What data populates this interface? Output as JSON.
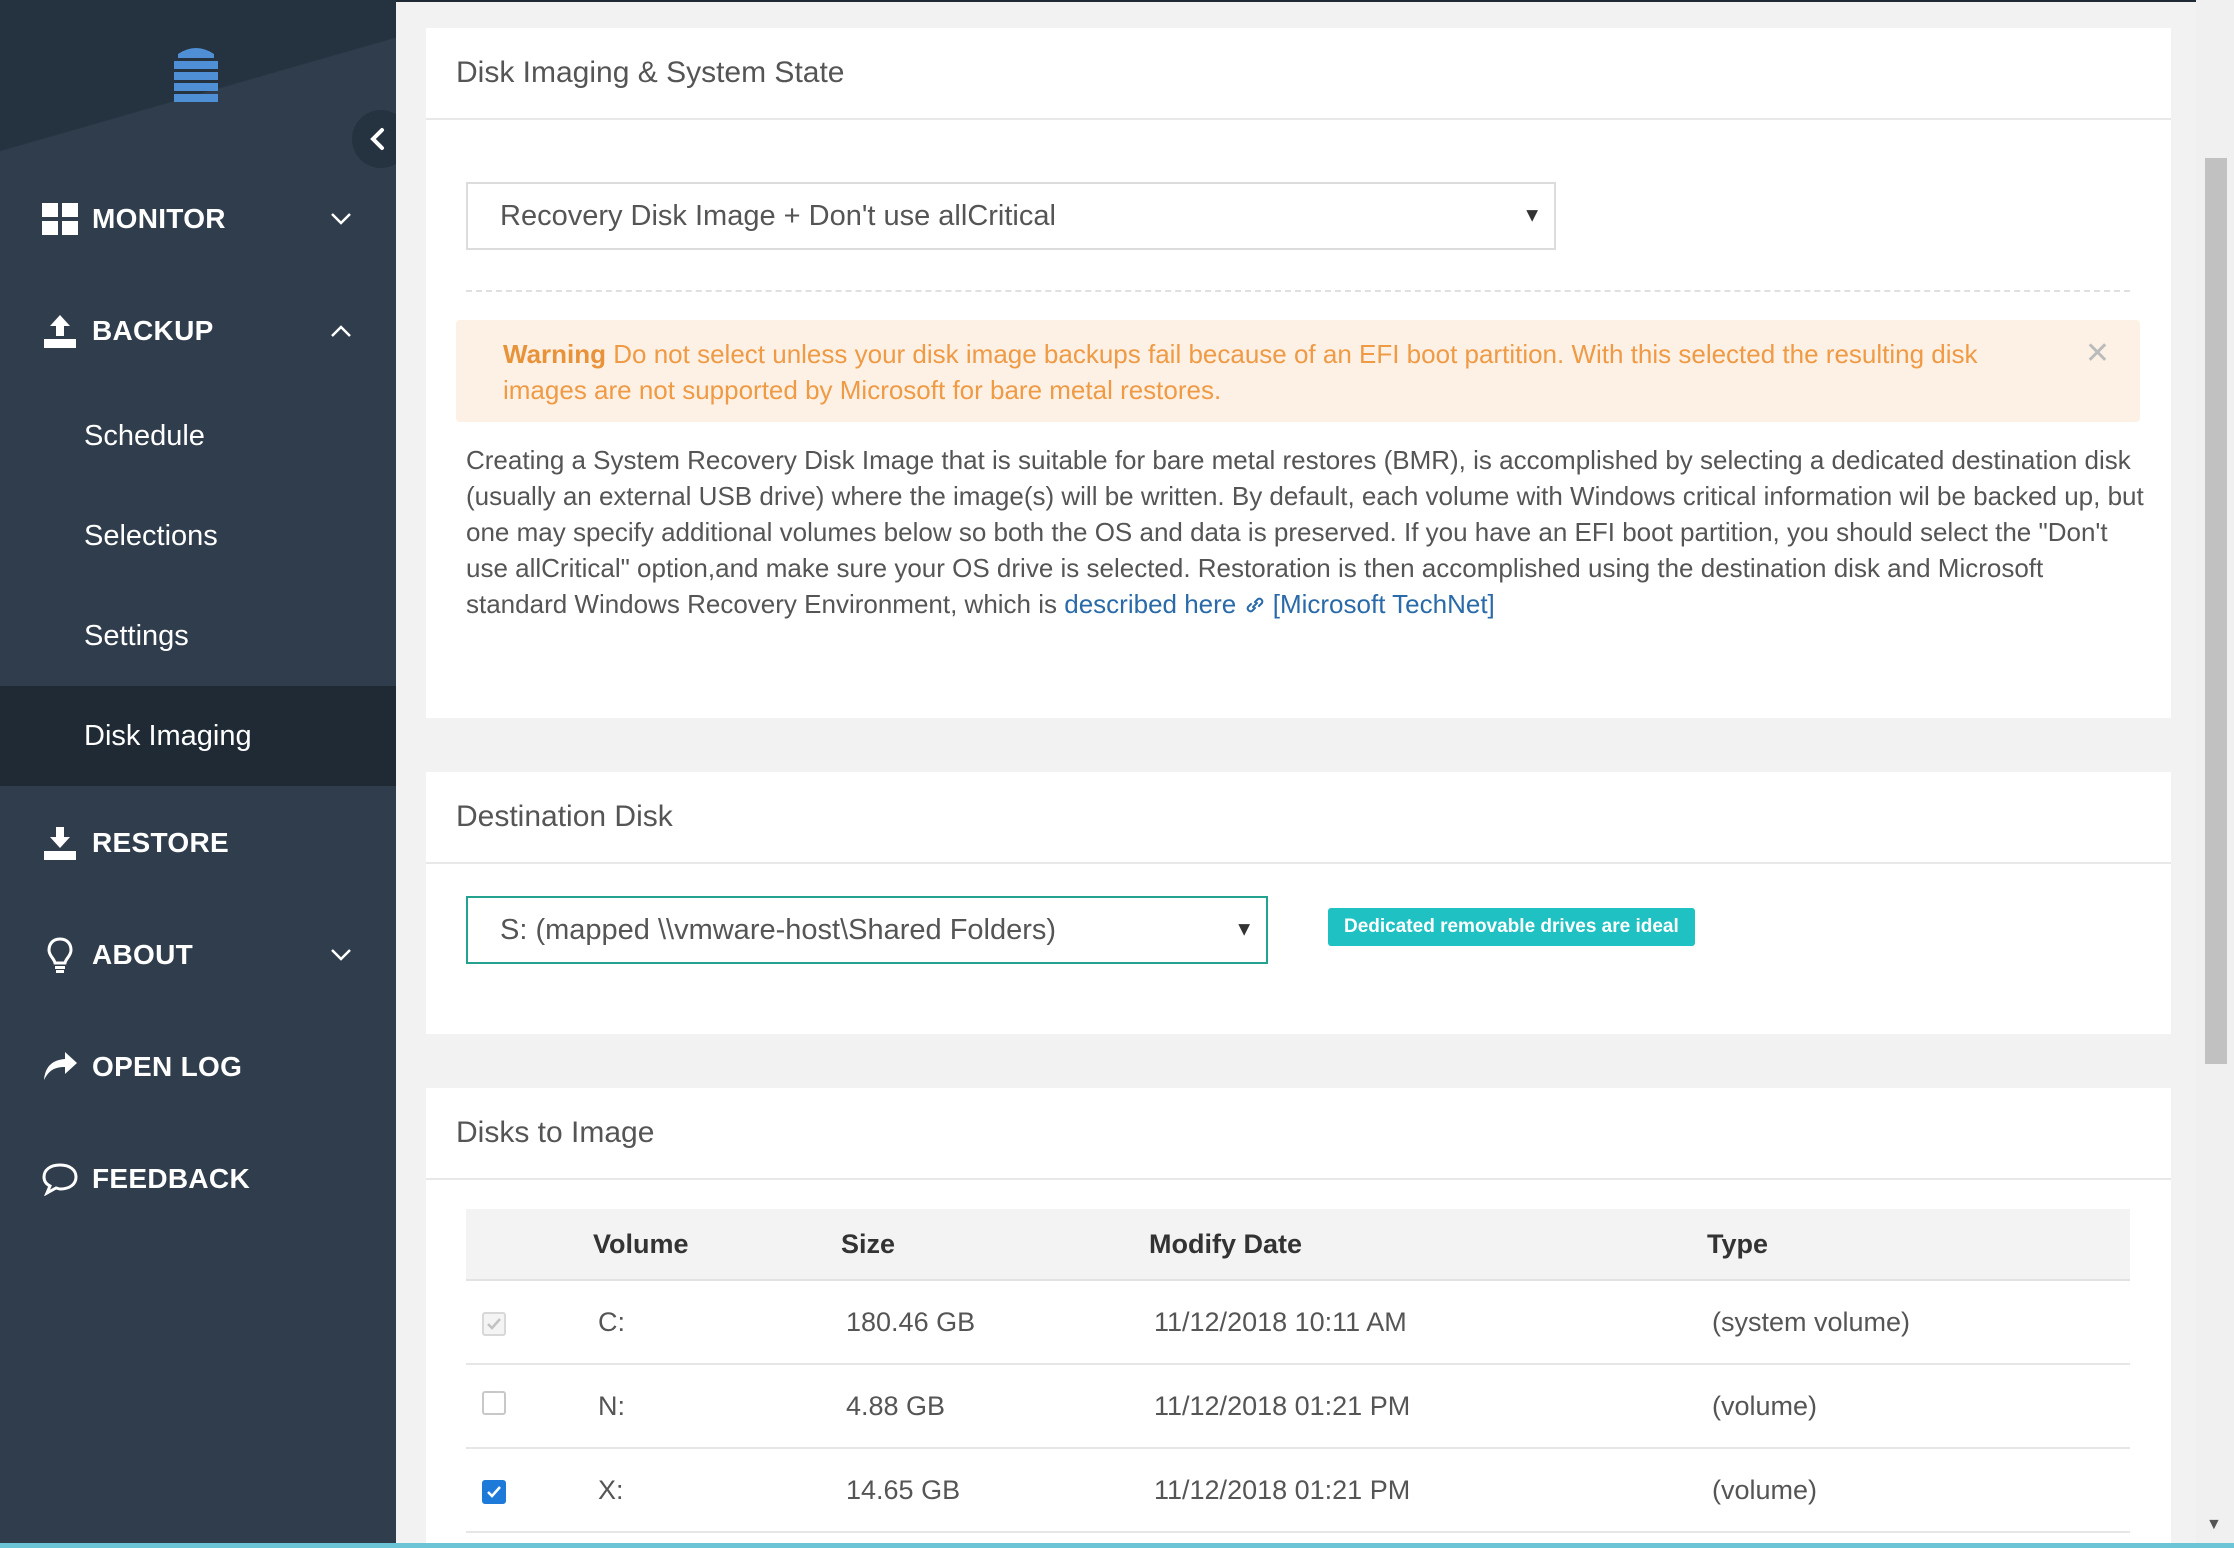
{
  "sidebar": {
    "monitor": "MONITOR",
    "backup": "BACKUP",
    "sub_items": [
      "Schedule",
      "Selections",
      "Settings",
      "Disk Imaging"
    ],
    "restore": "RESTORE",
    "about": "ABOUT",
    "open_log": "OPEN LOG",
    "feedback": "FEEDBACK",
    "active_item": "Disk Imaging"
  },
  "system_state": {
    "title": "Disk Imaging & System State",
    "mode_select": "Recovery Disk Image + Don't use allCritical",
    "warning_label": "Warning",
    "warning_text": "Do not select unless your disk image backups fail because of an EFI boot partition. With this selected the resulting disk images are not supported by Microsoft for bare metal restores.",
    "description": "Creating a System Recovery Disk Image that is suitable for bare metal restores (BMR), is accomplished by selecting a dedicated destination disk (usually an external USB drive) where the image(s) will be written. By default, each volume with Windows critical information wil be backed up, but one may specify additional volumes below so both the OS and data is preserved. If you have an EFI boot partition, you should select the \"Don't use allCritical\" option,and make sure your OS drive is selected. Restoration is then accomplished using the destination disk and Microsoft standard Windows Recovery Environment, which is",
    "link_text": "described here",
    "link_suffix": "[Microsoft TechNet]"
  },
  "destination": {
    "title": "Destination Disk",
    "select": "S: (mapped \\\\vmware-host\\Shared Folders)",
    "badge": "Dedicated removable drives are ideal"
  },
  "disks": {
    "title": "Disks to Image",
    "headers": [
      "Volume",
      "Size",
      "Modify Date",
      "Type"
    ],
    "rows": [
      {
        "volume": "C:",
        "size": "180.46 GB",
        "date": "11/12/2018 10:11 AM",
        "type": "(system volume)",
        "state": "checked-disabled"
      },
      {
        "volume": "N:",
        "size": "4.88 GB",
        "date": "11/12/2018 01:21 PM",
        "type": "(volume)",
        "state": "unchecked"
      },
      {
        "volume": "X:",
        "size": "14.65 GB",
        "date": "11/12/2018 01:21 PM",
        "type": "(volume)",
        "state": "checked"
      }
    ]
  },
  "colors": {
    "sidebar_bg": "#2f3d4c",
    "sidebar_active": "#1f2a35",
    "warning_text": "#ef9a45",
    "link": "#2a6aa8",
    "badge": "#1fc1c3",
    "checkbox_checked": "#1e7ad8"
  }
}
